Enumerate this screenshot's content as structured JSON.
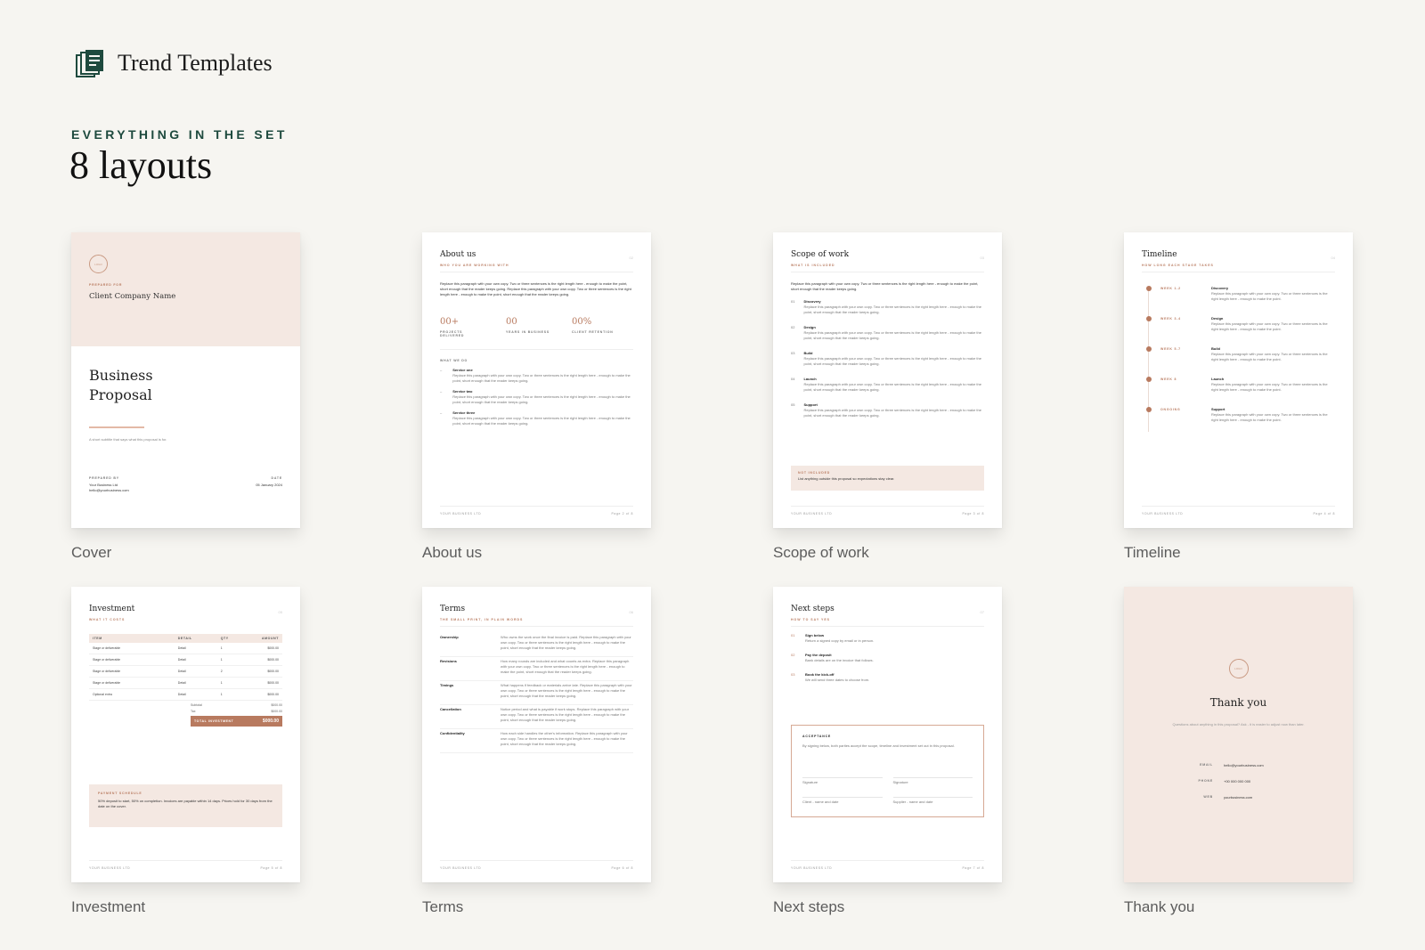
{
  "brand": {
    "name": "Trend Templates",
    "icon": "documents-stack-icon",
    "color": "#1e4a3e"
  },
  "eyebrow": "EVERYTHING IN THE SET",
  "headline": "8 layouts",
  "accent": "#b87a5f",
  "blush": "#f4e8e2",
  "captions": [
    "Cover",
    "About us",
    "Scope of work",
    "Timeline",
    "Investment",
    "Terms",
    "Next steps",
    "Thank you"
  ],
  "cover": {
    "logo": "LOGO",
    "prepared_for": "PREPARED FOR",
    "client": "Client Company Name",
    "title_line1": "Business",
    "title_line2": "Proposal",
    "subtitle": "A short subtitle that says what this proposal is for.",
    "prepared_by_label": "PREPARED BY",
    "prepared_by_name": "Your Business Ltd",
    "prepared_by_email": "hello@yourbusiness.com",
    "date_label": "DATE",
    "date": "05 January 2024"
  },
  "about": {
    "title": "About us",
    "sub": "WHO YOU ARE WORKING WITH",
    "pnum": "02",
    "intro": "Replace this paragraph with your own copy. Two or three sentences is the right length here - enough to make the point, short enough that the reader keeps going. Replace this paragraph with your own copy. Two or three sentences is the right length here - enough to make the point, short enough that the reader keeps going.",
    "stats": [
      {
        "value": "00+",
        "label": "PROJECTS DELIVERED"
      },
      {
        "value": "00",
        "label": "YEARS IN BUSINESS"
      },
      {
        "value": "00%",
        "label": "CLIENT RETENTION"
      }
    ],
    "what_we_do": "WHAT WE DO",
    "services": [
      {
        "name": "Service one",
        "desc": "Replace this paragraph with your own copy. Two or three sentences is the right length here - enough to make the point, short enough that the reader keeps going."
      },
      {
        "name": "Service two",
        "desc": "Replace this paragraph with your own copy. Two or three sentences is the right length here - enough to make the point, short enough that the reader keeps going."
      },
      {
        "name": "Service three",
        "desc": "Replace this paragraph with your own copy. Two or three sentences is the right length here - enough to make the point, short enough that the reader keeps going."
      }
    ],
    "footer_left": "YOUR BUSINESS LTD",
    "footer_right": "Page 2 of 8"
  },
  "scope": {
    "title": "Scope of work",
    "sub": "WHAT IS INCLUDED",
    "pnum": "03",
    "intro": "Replace this paragraph with your own copy. Two or three sentences is the right length here - enough to make the point, short enough that the reader keeps going.",
    "items": [
      {
        "num": "01",
        "name": "Discovery",
        "desc": "Replace this paragraph with your own copy. Two or three sentences is the right length here - enough to make the point, short enough that the reader keeps going."
      },
      {
        "num": "02",
        "name": "Design",
        "desc": "Replace this paragraph with your own copy. Two or three sentences is the right length here - enough to make the point, short enough that the reader keeps going."
      },
      {
        "num": "03",
        "name": "Build",
        "desc": "Replace this paragraph with your own copy. Two or three sentences is the right length here - enough to make the point, short enough that the reader keeps going."
      },
      {
        "num": "04",
        "name": "Launch",
        "desc": "Replace this paragraph with your own copy. Two or three sentences is the right length here - enough to make the point, short enough that the reader keeps going."
      },
      {
        "num": "05",
        "name": "Support",
        "desc": "Replace this paragraph with your own copy. Two or three sentences is the right length here - enough to make the point, short enough that the reader keeps going."
      }
    ],
    "not_included_label": "NOT INCLUDED",
    "not_included_text": "List anything outside this proposal so expectations stay clear.",
    "footer_left": "YOUR BUSINESS LTD",
    "footer_right": "Page 3 of 8"
  },
  "timeline": {
    "title": "Timeline",
    "sub": "HOW LONG EACH STAGE TAKES",
    "pnum": "04",
    "stages": [
      {
        "week": "WEEK 1-2",
        "name": "Discovery",
        "desc": "Replace this paragraph with your own copy. Two or three sentences is the right length here - enough to make the point."
      },
      {
        "week": "WEEK 3-4",
        "name": "Design",
        "desc": "Replace this paragraph with your own copy. Two or three sentences is the right length here - enough to make the point."
      },
      {
        "week": "WEEK 5-7",
        "name": "Build",
        "desc": "Replace this paragraph with your own copy. Two or three sentences is the right length here - enough to make the point."
      },
      {
        "week": "WEEK 8",
        "name": "Launch",
        "desc": "Replace this paragraph with your own copy. Two or three sentences is the right length here - enough to make the point."
      },
      {
        "week": "ONGOING",
        "name": "Support",
        "desc": "Replace this paragraph with your own copy. Two or three sentences is the right length here - enough to make the point."
      }
    ],
    "footer_left": "YOUR BUSINESS LTD",
    "footer_right": "Page 4 of 8"
  },
  "investment": {
    "title": "Investment",
    "sub": "WHAT IT COSTS",
    "pnum": "05",
    "columns": [
      "ITEM",
      "DETAIL",
      "QTY",
      "AMOUNT"
    ],
    "rows": [
      [
        "Stage or deliverable",
        "Detail",
        "1",
        "$000.00"
      ],
      [
        "Stage or deliverable",
        "Detail",
        "1",
        "$000.00"
      ],
      [
        "Stage or deliverable",
        "Detail",
        "2",
        "$000.00"
      ],
      [
        "Stage or deliverable",
        "Detail",
        "1",
        "$000.00"
      ],
      [
        "Optional extra",
        "Detail",
        "1",
        "$000.00"
      ]
    ],
    "subtotal_label": "Subtotal",
    "subtotal": "$000.00",
    "tax_label": "Tax",
    "tax": "$000.00",
    "total_label": "TOTAL INVESTMENT",
    "total": "$000.00",
    "schedule_label": "PAYMENT SCHEDULE",
    "schedule_text": "50% deposit to start, 50% on completion. Invoices are payable within 14 days. Prices hold for 30 days from the date on the cover.",
    "footer_left": "YOUR BUSINESS LTD",
    "footer_right": "Page 5 of 8"
  },
  "terms": {
    "title": "Terms",
    "sub": "THE SMALL PRINT, IN PLAIN WORDS",
    "pnum": "06",
    "items": [
      {
        "name": "Ownership",
        "desc": "Who owns the work once the final invoice is paid. Replace this paragraph with your own copy. Two or three sentences is the right length here - enough to make the point, short enough that the reader keeps going."
      },
      {
        "name": "Revisions",
        "desc": "How many rounds are included and what counts as extra. Replace this paragraph with your own copy. Two or three sentences is the right length here - enough to make the point, short enough that the reader keeps going."
      },
      {
        "name": "Timings",
        "desc": "What happens if feedback or materials arrive late. Replace this paragraph with your own copy. Two or three sentences is the right length here - enough to make the point, short enough that the reader keeps going."
      },
      {
        "name": "Cancellation",
        "desc": "Notice period and what is payable if work stops. Replace this paragraph with your own copy. Two or three sentences is the right length here - enough to make the point, short enough that the reader keeps going."
      },
      {
        "name": "Confidentiality",
        "desc": "How each side handles the other's information. Replace this paragraph with your own copy. Two or three sentences is the right length here - enough to make the point, short enough that the reader keeps going."
      }
    ],
    "footer_left": "YOUR BUSINESS LTD",
    "footer_right": "Page 6 of 8"
  },
  "next": {
    "title": "Next steps",
    "sub": "HOW TO SAY YES",
    "pnum": "07",
    "steps": [
      {
        "num": "01",
        "name": "Sign below",
        "desc": "Return a signed copy by email or in person."
      },
      {
        "num": "02",
        "name": "Pay the deposit",
        "desc": "Bank details are on the invoice that follows."
      },
      {
        "num": "03",
        "name": "Book the kick-off",
        "desc": "We will send three dates to choose from."
      }
    ],
    "acceptance_label": "ACCEPTANCE",
    "acceptance_text": "By signing below, both parties accept the scope, timeline and investment set out in this proposal.",
    "sig_left": "Signature",
    "sig_right": "Signature",
    "name_left": "Client - name and date",
    "name_right": "Supplier - name and date",
    "footer_left": "YOUR BUSINESS LTD",
    "footer_right": "Page 7 of 8"
  },
  "thanks": {
    "logo": "LOGO",
    "title": "Thank you",
    "sub": "Questions about anything in this proposal? Ask - it is easier to adjust now than later.",
    "contacts": [
      {
        "label": "EMAIL",
        "value": "hello@yourbusiness.com"
      },
      {
        "label": "PHONE",
        "value": "+00 000 000 000"
      },
      {
        "label": "WEB",
        "value": "yourbusiness.com"
      }
    ]
  }
}
